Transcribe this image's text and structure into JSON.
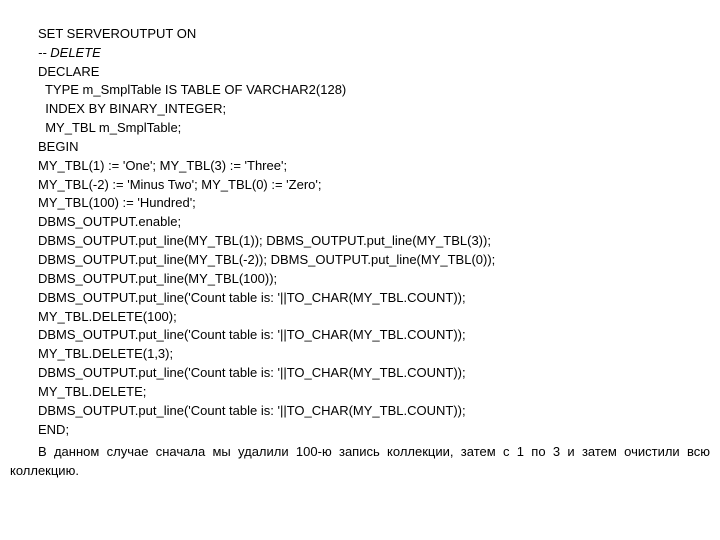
{
  "code": {
    "l1": "SET SERVEROUTPUT ON",
    "l2": "-- DELETE",
    "l3": "DECLARE",
    "l4": "  TYPE m_SmplTable IS TABLE OF VARCHAR2(128)",
    "l5": "  INDEX BY BINARY_INTEGER;",
    "l6": "  MY_TBL m_SmplTable;",
    "l7": "BEGIN",
    "l8": "MY_TBL(1) := 'One'; MY_TBL(3) := 'Three';",
    "l9": "MY_TBL(-2) := 'Minus Two'; MY_TBL(0) := 'Zero';",
    "l10": "MY_TBL(100) := 'Hundred';",
    "l11": "DBMS_OUTPUT.enable;",
    "l12": "DBMS_OUTPUT.put_line(MY_TBL(1)); DBMS_OUTPUT.put_line(MY_TBL(3));",
    "l13": "DBMS_OUTPUT.put_line(MY_TBL(-2)); DBMS_OUTPUT.put_line(MY_TBL(0));",
    "l14": "DBMS_OUTPUT.put_line(MY_TBL(100));",
    "l15": "DBMS_OUTPUT.put_line('Count table is: '||TO_CHAR(MY_TBL.COUNT));",
    "l16": "MY_TBL.DELETE(100);",
    "l17": "DBMS_OUTPUT.put_line('Count table is: '||TO_CHAR(MY_TBL.COUNT));",
    "l18": "MY_TBL.DELETE(1,3);",
    "l19": "DBMS_OUTPUT.put_line('Count table is: '||TO_CHAR(MY_TBL.COUNT));",
    "l20": "MY_TBL.DELETE;",
    "l21": "DBMS_OUTPUT.put_line('Count table is: '||TO_CHAR(MY_TBL.COUNT));",
    "l22": "END;"
  },
  "paragraph": {
    "text": "В данном случае сначала мы удалили 100-ю запись коллекции, затем с 1 по 3 и затем очистили всю коллекцию."
  }
}
